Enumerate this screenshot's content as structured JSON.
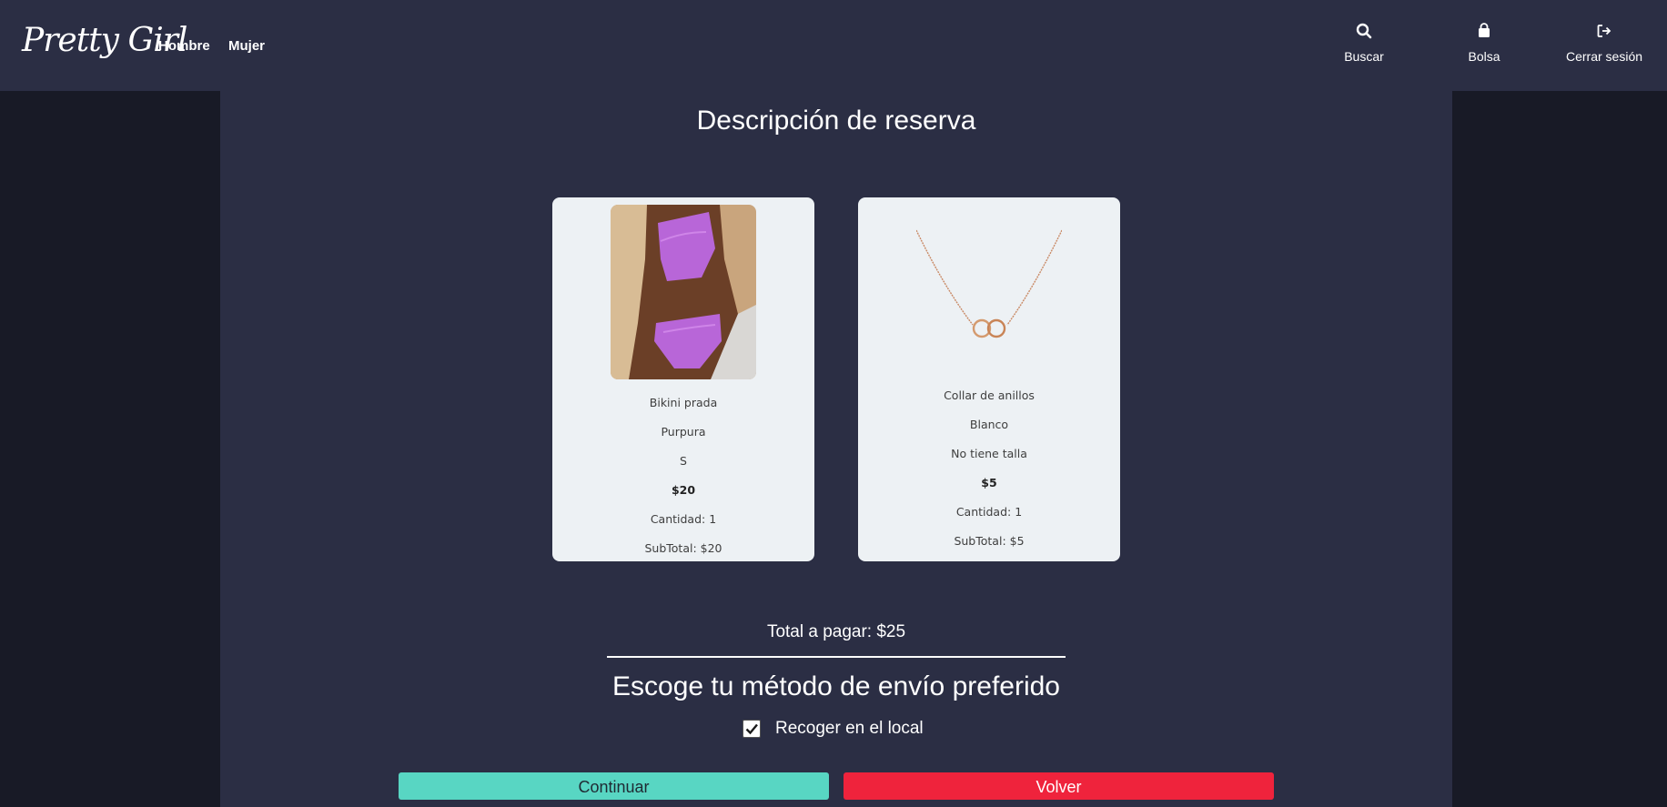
{
  "navbar": {
    "logo": "Pretty Girl",
    "links": [
      "Hombre",
      "Mujer"
    ],
    "actions": [
      {
        "label": "Buscar",
        "icon": "search-icon"
      },
      {
        "label": "Bolsa",
        "icon": "bag-icon"
      },
      {
        "label": "Cerrar sesión",
        "icon": "logout-icon"
      }
    ]
  },
  "main": {
    "title": "Descripción de reserva",
    "products": [
      {
        "name": "Bikini prada",
        "color": "Purpura",
        "size": "S",
        "price": "$20",
        "quantity": "Cantidad: 1",
        "subtotal": "SubTotal: $20"
      },
      {
        "name": "Collar de anillos",
        "color": "Blanco",
        "size": "No tiene talla",
        "price": "$5",
        "quantity": "Cantidad: 1",
        "subtotal": "SubTotal: $5"
      }
    ],
    "total": "Total a pagar: $25",
    "shipping_title": "Escoge tu método de envío preferido",
    "shipping_option": "Recoger en el local",
    "shipping_checked": true,
    "continue_label": "Continuar",
    "back_label": "Volver"
  },
  "colors": {
    "page_bg": "#181a26",
    "panel_bg": "#2b2e44",
    "card_bg": "#edf1f4",
    "continue": "#58d6c3",
    "back": "#ef233c"
  }
}
